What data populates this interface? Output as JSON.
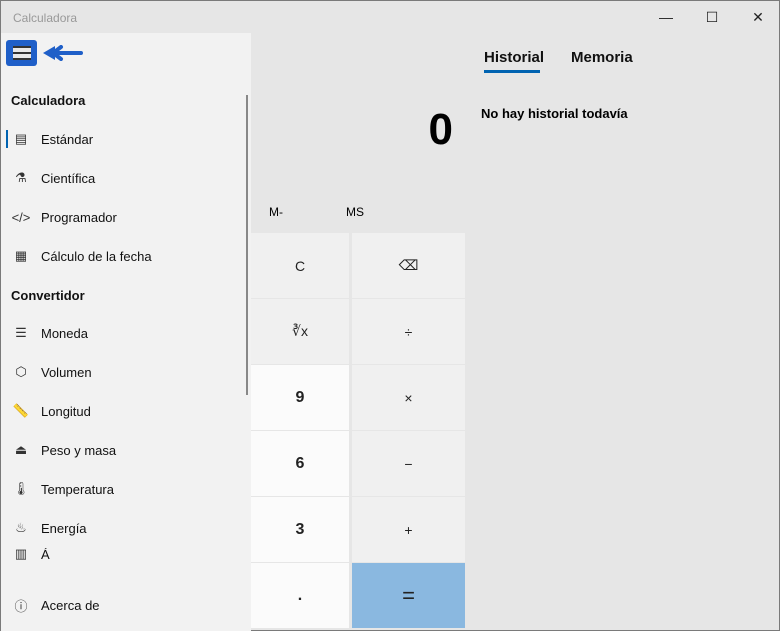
{
  "window": {
    "title": "Calculadora",
    "minimize": "—",
    "maximize": "☐",
    "close": "✕"
  },
  "nav": {
    "section_calc": "Calculadora",
    "calc_items": [
      {
        "label": "Estándar",
        "icon": "calculator-icon",
        "glyph": "▤"
      },
      {
        "label": "Científica",
        "icon": "flask-icon",
        "glyph": "⚗"
      },
      {
        "label": "Programador",
        "icon": "code-icon",
        "glyph": "</>"
      },
      {
        "label": "Cálculo de la fecha",
        "icon": "calendar-icon",
        "glyph": "▦"
      }
    ],
    "section_conv": "Convertidor",
    "conv_items": [
      {
        "label": "Moneda",
        "icon": "coins-icon",
        "glyph": "☰"
      },
      {
        "label": "Volumen",
        "icon": "cube-icon",
        "glyph": "⬡"
      },
      {
        "label": "Longitud",
        "icon": "ruler-icon",
        "glyph": "📏"
      },
      {
        "label": "Peso y masa",
        "icon": "weight-icon",
        "glyph": "⏏"
      },
      {
        "label": "Temperatura",
        "icon": "thermometer-icon",
        "glyph": "🌡"
      },
      {
        "label": "Energía",
        "icon": "flame-icon",
        "glyph": "♨"
      },
      {
        "label": "Á",
        "icon": "area-icon",
        "glyph": "▥"
      }
    ],
    "about": {
      "label": "Acerca de",
      "icon": "info-icon",
      "glyph": "ⓘ"
    },
    "selected": "Estándar"
  },
  "display": {
    "value": "0"
  },
  "memory": {
    "m_minus": "M-",
    "ms": "MS"
  },
  "keys": [
    [
      "C",
      "⌫"
    ],
    [
      "∛x",
      "÷"
    ],
    [
      "9",
      "×"
    ],
    [
      "6",
      "−"
    ],
    [
      "3",
      "+"
    ],
    [
      ".",
      "="
    ]
  ],
  "history": {
    "tabs": [
      "Historial",
      "Memoria"
    ],
    "active": "Historial",
    "empty": "No hay historial todavía"
  },
  "colors": {
    "accent": "#0063b1",
    "equals": "#8ab8e0",
    "highlight": "#1f5fc8"
  }
}
